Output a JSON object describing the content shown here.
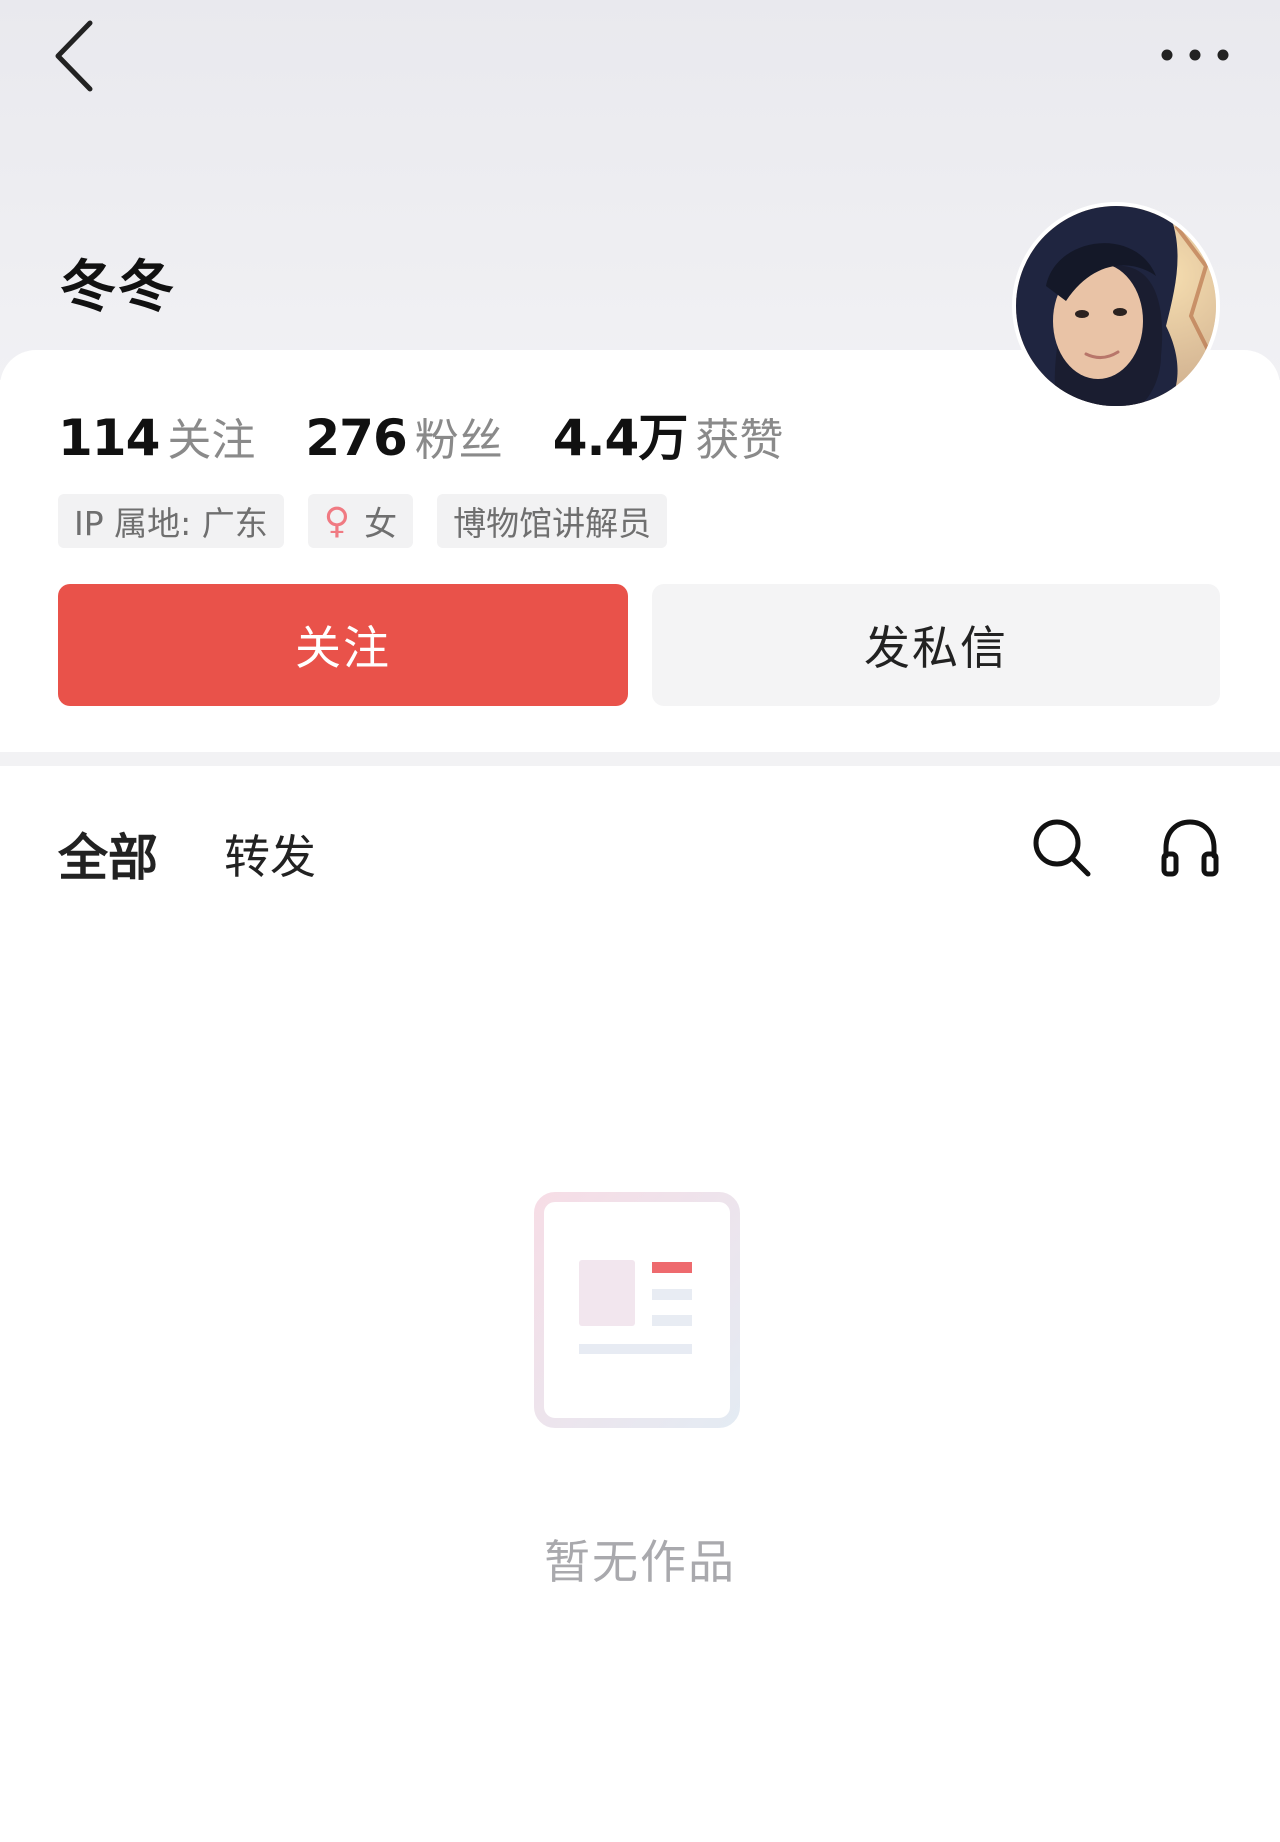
{
  "header": {
    "back_icon": "chevron-left-icon",
    "more_icon": "more-dots-icon"
  },
  "profile": {
    "name": "冬冬",
    "avatar_alt": "avatar"
  },
  "stats": [
    {
      "value": "114",
      "label": "关注"
    },
    {
      "value": "276",
      "label": "粉丝"
    },
    {
      "value": "4.4万",
      "label": "获赞"
    }
  ],
  "tags": {
    "ip": "IP 属地: 广东",
    "gender_symbol": "♀",
    "gender": "女",
    "occupation": "博物馆讲解员"
  },
  "actions": {
    "follow": "关注",
    "message": "发私信"
  },
  "tabs": {
    "all": "全部",
    "repost": "转发"
  },
  "tools": {
    "search_icon": "search-icon",
    "listen_icon": "headphones-icon"
  },
  "empty": {
    "text": "暂无作品"
  },
  "colors": {
    "accent": "#e9524a",
    "female": "#f07a82"
  }
}
